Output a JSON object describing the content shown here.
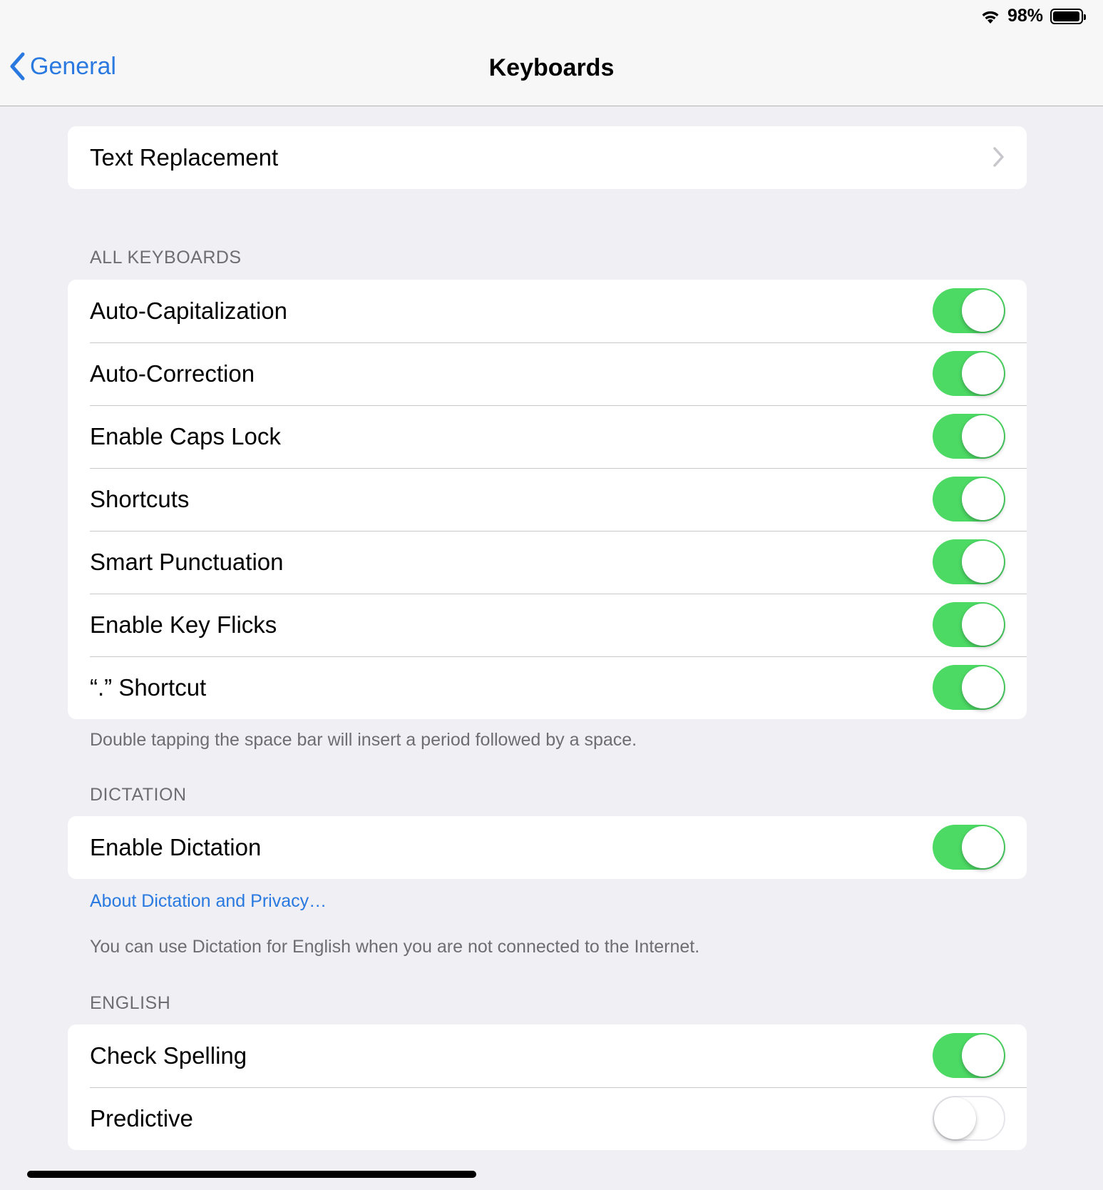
{
  "status_bar": {
    "battery_percent": "98%",
    "battery_level": 0.98,
    "icons": [
      "wifi-icon",
      "battery-icon"
    ]
  },
  "nav": {
    "back_label": "General",
    "title": "Keyboards"
  },
  "text_replacement": {
    "label": "Text Replacement"
  },
  "all_keyboards": {
    "header": "ALL KEYBOARDS",
    "items": [
      {
        "label": "Auto-Capitalization",
        "on": true
      },
      {
        "label": "Auto-Correction",
        "on": true
      },
      {
        "label": "Enable Caps Lock",
        "on": true
      },
      {
        "label": "Shortcuts",
        "on": true
      },
      {
        "label": "Smart Punctuation",
        "on": true
      },
      {
        "label": "Enable Key Flicks",
        "on": true
      },
      {
        "label": "“.” Shortcut",
        "on": true
      }
    ],
    "footer": "Double tapping the space bar will insert a period followed by a space."
  },
  "dictation": {
    "header": "DICTATION",
    "items": [
      {
        "label": "Enable Dictation",
        "on": true
      }
    ],
    "link": "About Dictation and Privacy…",
    "footer": "You can use Dictation for English when you are not connected to the Internet."
  },
  "english": {
    "header": "ENGLISH",
    "items": [
      {
        "label": "Check Spelling",
        "on": true
      },
      {
        "label": "Predictive",
        "on": false
      }
    ]
  },
  "colors": {
    "accent": "#2979e0",
    "toggle_on": "#4cd964",
    "background": "#efeff4"
  }
}
